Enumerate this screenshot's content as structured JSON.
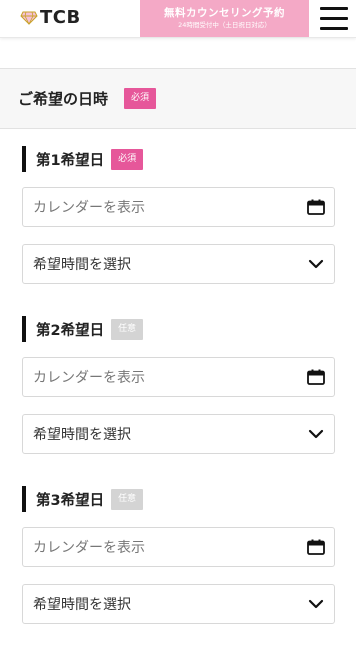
{
  "header": {
    "logo_text": "TCB",
    "reserve_main": "無料カウンセリング予約",
    "reserve_sub": "24時間受付中（土日祝日対応）",
    "menu_icon": "hamburger-menu-icon"
  },
  "section": {
    "title": "ご希望の日時",
    "badge": "必須"
  },
  "groups": [
    {
      "label": "第1希望日",
      "badge": "必須",
      "badge_type": "required",
      "date_placeholder": "カレンダーを表示",
      "time_value": "希望時間を選択"
    },
    {
      "label": "第2希望日",
      "badge": "任意",
      "badge_type": "optional",
      "date_placeholder": "カレンダーを表示",
      "time_value": "希望時間を選択"
    },
    {
      "label": "第3希望日",
      "badge": "任意",
      "badge_type": "optional",
      "date_placeholder": "カレンダーを表示",
      "time_value": "希望時間を選択"
    }
  ],
  "colors": {
    "required_badge": "#e6579a",
    "optional_badge": "#d4d4d4",
    "reserve_button": "#f4a9c6"
  },
  "icons": {
    "date": "calendar-icon",
    "time": "chevron-down-icon"
  }
}
